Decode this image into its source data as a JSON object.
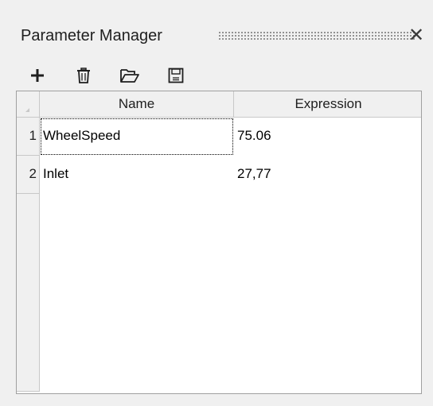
{
  "panel": {
    "title": "Parameter Manager",
    "close_glyph": "✕"
  },
  "toolbar": {
    "items": [
      {
        "name": "add-parameter-button",
        "icon": "plus-icon"
      },
      {
        "name": "delete-parameter-button",
        "icon": "trash-icon"
      },
      {
        "name": "open-file-button",
        "icon": "folder-open-icon"
      },
      {
        "name": "save-file-button",
        "icon": "save-disk-icon"
      }
    ]
  },
  "grid": {
    "columns": [
      "Name",
      "Expression"
    ],
    "rows": [
      {
        "index": "1",
        "name": "WheelSpeed",
        "expression": "75.06"
      },
      {
        "index": "2",
        "name": "Inlet",
        "expression": "27,77"
      }
    ]
  }
}
